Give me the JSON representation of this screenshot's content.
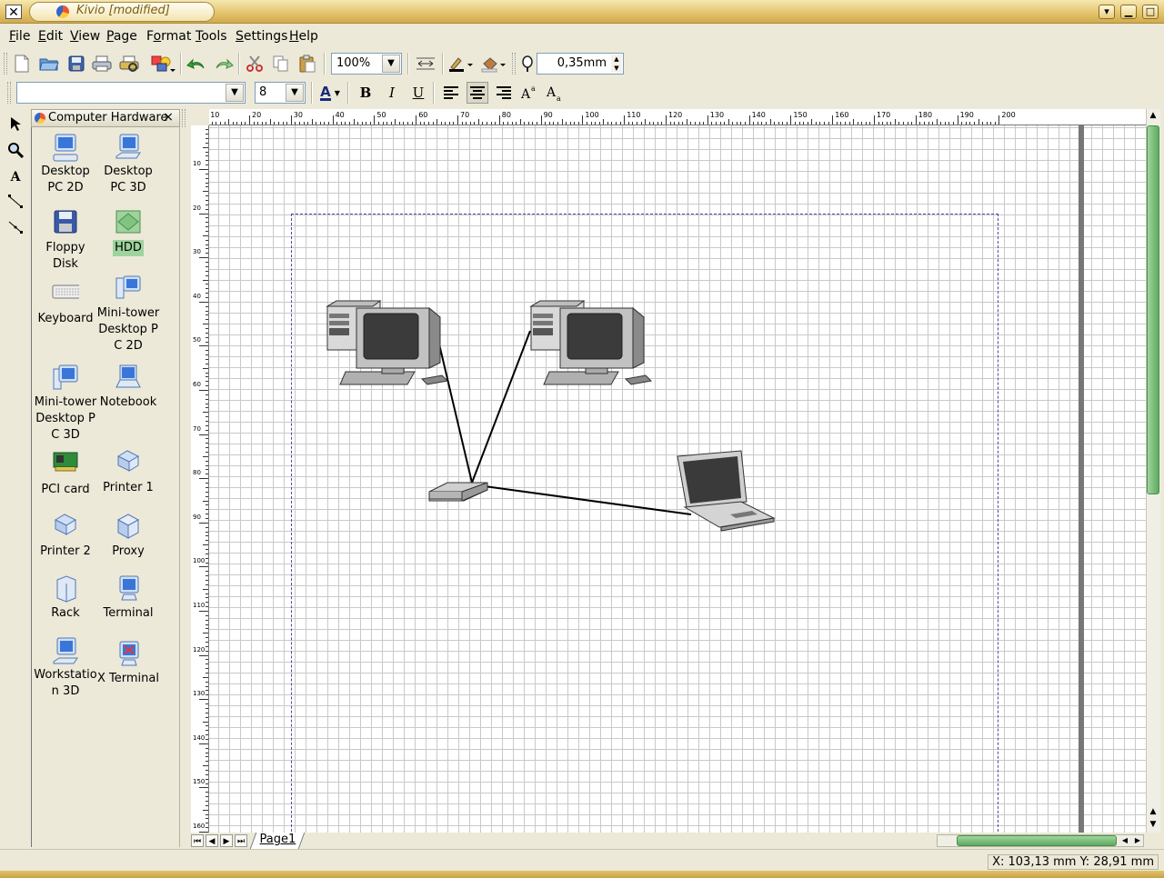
{
  "window": {
    "title": "Kivio [modified]",
    "close_glyph": "✕",
    "buttons": {
      "menu_glyph": "▾",
      "minimize_glyph": "▁",
      "maximize_glyph": "□",
      "close_glyph": "✕"
    }
  },
  "menu": [
    {
      "label": "File",
      "mnemonic": "F"
    },
    {
      "label": "Edit",
      "mnemonic": "E"
    },
    {
      "label": "View",
      "mnemonic": "V"
    },
    {
      "label": "Page",
      "mnemonic": "P"
    },
    {
      "label": "Format",
      "mnemonic": "o"
    },
    {
      "label": "Tools",
      "mnemonic": "T"
    },
    {
      "label": "Settings",
      "mnemonic": "S"
    },
    {
      "label": "Help",
      "mnemonic": "H"
    }
  ],
  "toolbar1": {
    "zoom_value": "100%",
    "line_width_value": "0,35mm",
    "icons": [
      "new-icon",
      "open-icon",
      "save-icon",
      "print-icon",
      "print-preview-icon",
      "stencil-set-icon",
      "undo-icon",
      "redo-icon",
      "cut-icon",
      "copy-icon",
      "paste-icon"
    ]
  },
  "toolbar2": {
    "font_name": "",
    "font_size": "8",
    "bold_label": "B",
    "italic_label": "I",
    "underline_label": "U",
    "text_color_label": "A"
  },
  "stencil_panel": {
    "title": "Computer Hardware",
    "close_glyph": "×",
    "items": [
      {
        "label": "Desktop PC 2D",
        "icon": "desktop-pc-2d-icon"
      },
      {
        "label": "Desktop PC 3D",
        "icon": "desktop-pc-3d-icon"
      },
      {
        "label": "Floppy Disk",
        "icon": "floppy-disk-icon"
      },
      {
        "label": "HDD",
        "icon": "hdd-icon",
        "selected": true
      },
      {
        "label": "Keyboard",
        "icon": "keyboard-icon"
      },
      {
        "label": "Mini-tower Desktop PC 2D",
        "icon": "mini-tower-2d-icon"
      },
      {
        "label": "Mini-tower Desktop PC 3D",
        "icon": "mini-tower-3d-icon"
      },
      {
        "label": "Notebook",
        "icon": "notebook-icon"
      },
      {
        "label": "PCI card",
        "icon": "pci-card-icon"
      },
      {
        "label": "Printer 1",
        "icon": "printer-icon"
      },
      {
        "label": "Printer 2",
        "icon": "printer-icon"
      },
      {
        "label": "Proxy",
        "icon": "proxy-icon"
      },
      {
        "label": "Rack",
        "icon": "rack-icon"
      },
      {
        "label": "Terminal",
        "icon": "terminal-icon"
      },
      {
        "label": "Workstation 3D",
        "icon": "workstation-3d-icon"
      },
      {
        "label": "X Terminal",
        "icon": "x-terminal-icon"
      }
    ]
  },
  "rulers": {
    "horizontal_labels": [
      "10",
      "20",
      "30",
      "40",
      "50",
      "60",
      "70",
      "80",
      "90",
      "100",
      "110",
      "120",
      "130",
      "140",
      "150",
      "160",
      "170",
      "180",
      "190",
      "200"
    ],
    "vertical_labels": [
      "10",
      "20",
      "30",
      "40",
      "50",
      "60",
      "70",
      "80",
      "90",
      "100",
      "110",
      "120",
      "130",
      "140",
      "150",
      "160"
    ]
  },
  "page_tabs": {
    "current": "Page1"
  },
  "status": {
    "coords": "X: 103,13 mm Y: 28,91 mm"
  },
  "colors": {
    "title_bar": "#e2c26a",
    "accent_green": "#5faa5f",
    "page_border": "#4a4aa8",
    "grid": "#c9c9c9"
  }
}
